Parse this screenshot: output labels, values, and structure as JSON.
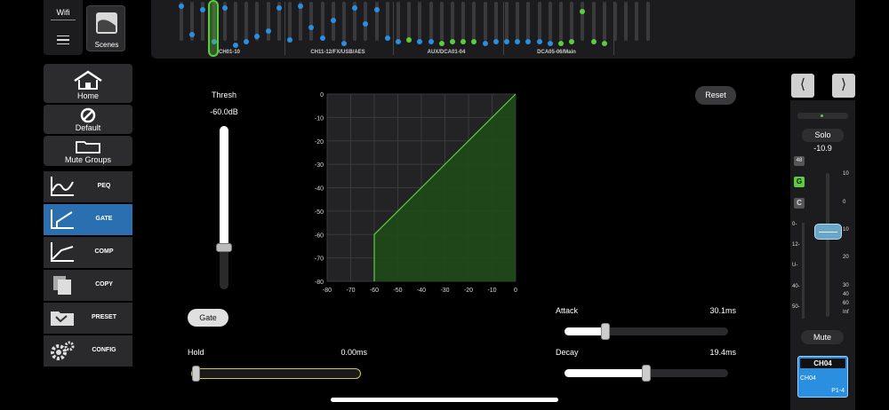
{
  "topbar": {
    "wifi_label": "Wifi",
    "scenes_label": "Scenes",
    "groups": [
      "CH01-10",
      "CH11-12/FX/USB/AES",
      "AUX/DCA01-04",
      "DCA05-06/Main"
    ]
  },
  "nav": {
    "home": "Home",
    "default": "Default",
    "mute_groups": "Mute Groups",
    "items": [
      {
        "label": "PEQ",
        "active": false
      },
      {
        "label": "GATE",
        "active": true
      },
      {
        "label": "COMP",
        "active": false
      },
      {
        "label": "COPY",
        "active": false
      },
      {
        "label": "PRESET",
        "active": false
      },
      {
        "label": "CONFIG",
        "active": false
      }
    ]
  },
  "thresh": {
    "label": "Thresh",
    "value": "-60.0dB",
    "level": 0.2
  },
  "gate_button": "Gate",
  "reset_button": "Reset",
  "hold": {
    "label": "Hold",
    "value": "0.00ms",
    "level": 0.0
  },
  "attack": {
    "label": "Attack",
    "value": "30.1ms",
    "level": 0.25
  },
  "decay": {
    "label": "Decay",
    "value": "19.4ms",
    "level": 0.5
  },
  "chart_data": {
    "type": "line",
    "xlim": [
      -80,
      0
    ],
    "ylim": [
      -80,
      0
    ],
    "x_ticks": [
      "-80",
      "-70",
      "-60",
      "-50",
      "-40",
      "-30",
      "-20",
      "-10",
      "0"
    ],
    "y_ticks": [
      "0",
      "-10",
      "-20",
      "-30",
      "-40",
      "-50",
      "-60",
      "-70",
      "-80"
    ],
    "series": [
      {
        "x": [
          -60,
          -60,
          0
        ],
        "y": [
          -80,
          -60,
          0
        ]
      }
    ],
    "grid": true,
    "color": "#5ccd3c"
  },
  "channel": {
    "solo_label": "Solo",
    "level_value": "-10.9",
    "badge_48": "48",
    "badge_g": "G",
    "badge_c": "C",
    "fader_scale": [
      "10",
      "0",
      "10",
      "20",
      "30",
      "40",
      "60",
      "Inf"
    ],
    "meter_scale": [
      "0-",
      "12-",
      "U-",
      "40-",
      "50-"
    ],
    "mute_label": "Mute",
    "name_header": "CH04",
    "name": "CH04",
    "input": "P1-4",
    "colors": {
      "accent": "#2a8fe0",
      "gate_green": "#5ccd3c"
    }
  }
}
